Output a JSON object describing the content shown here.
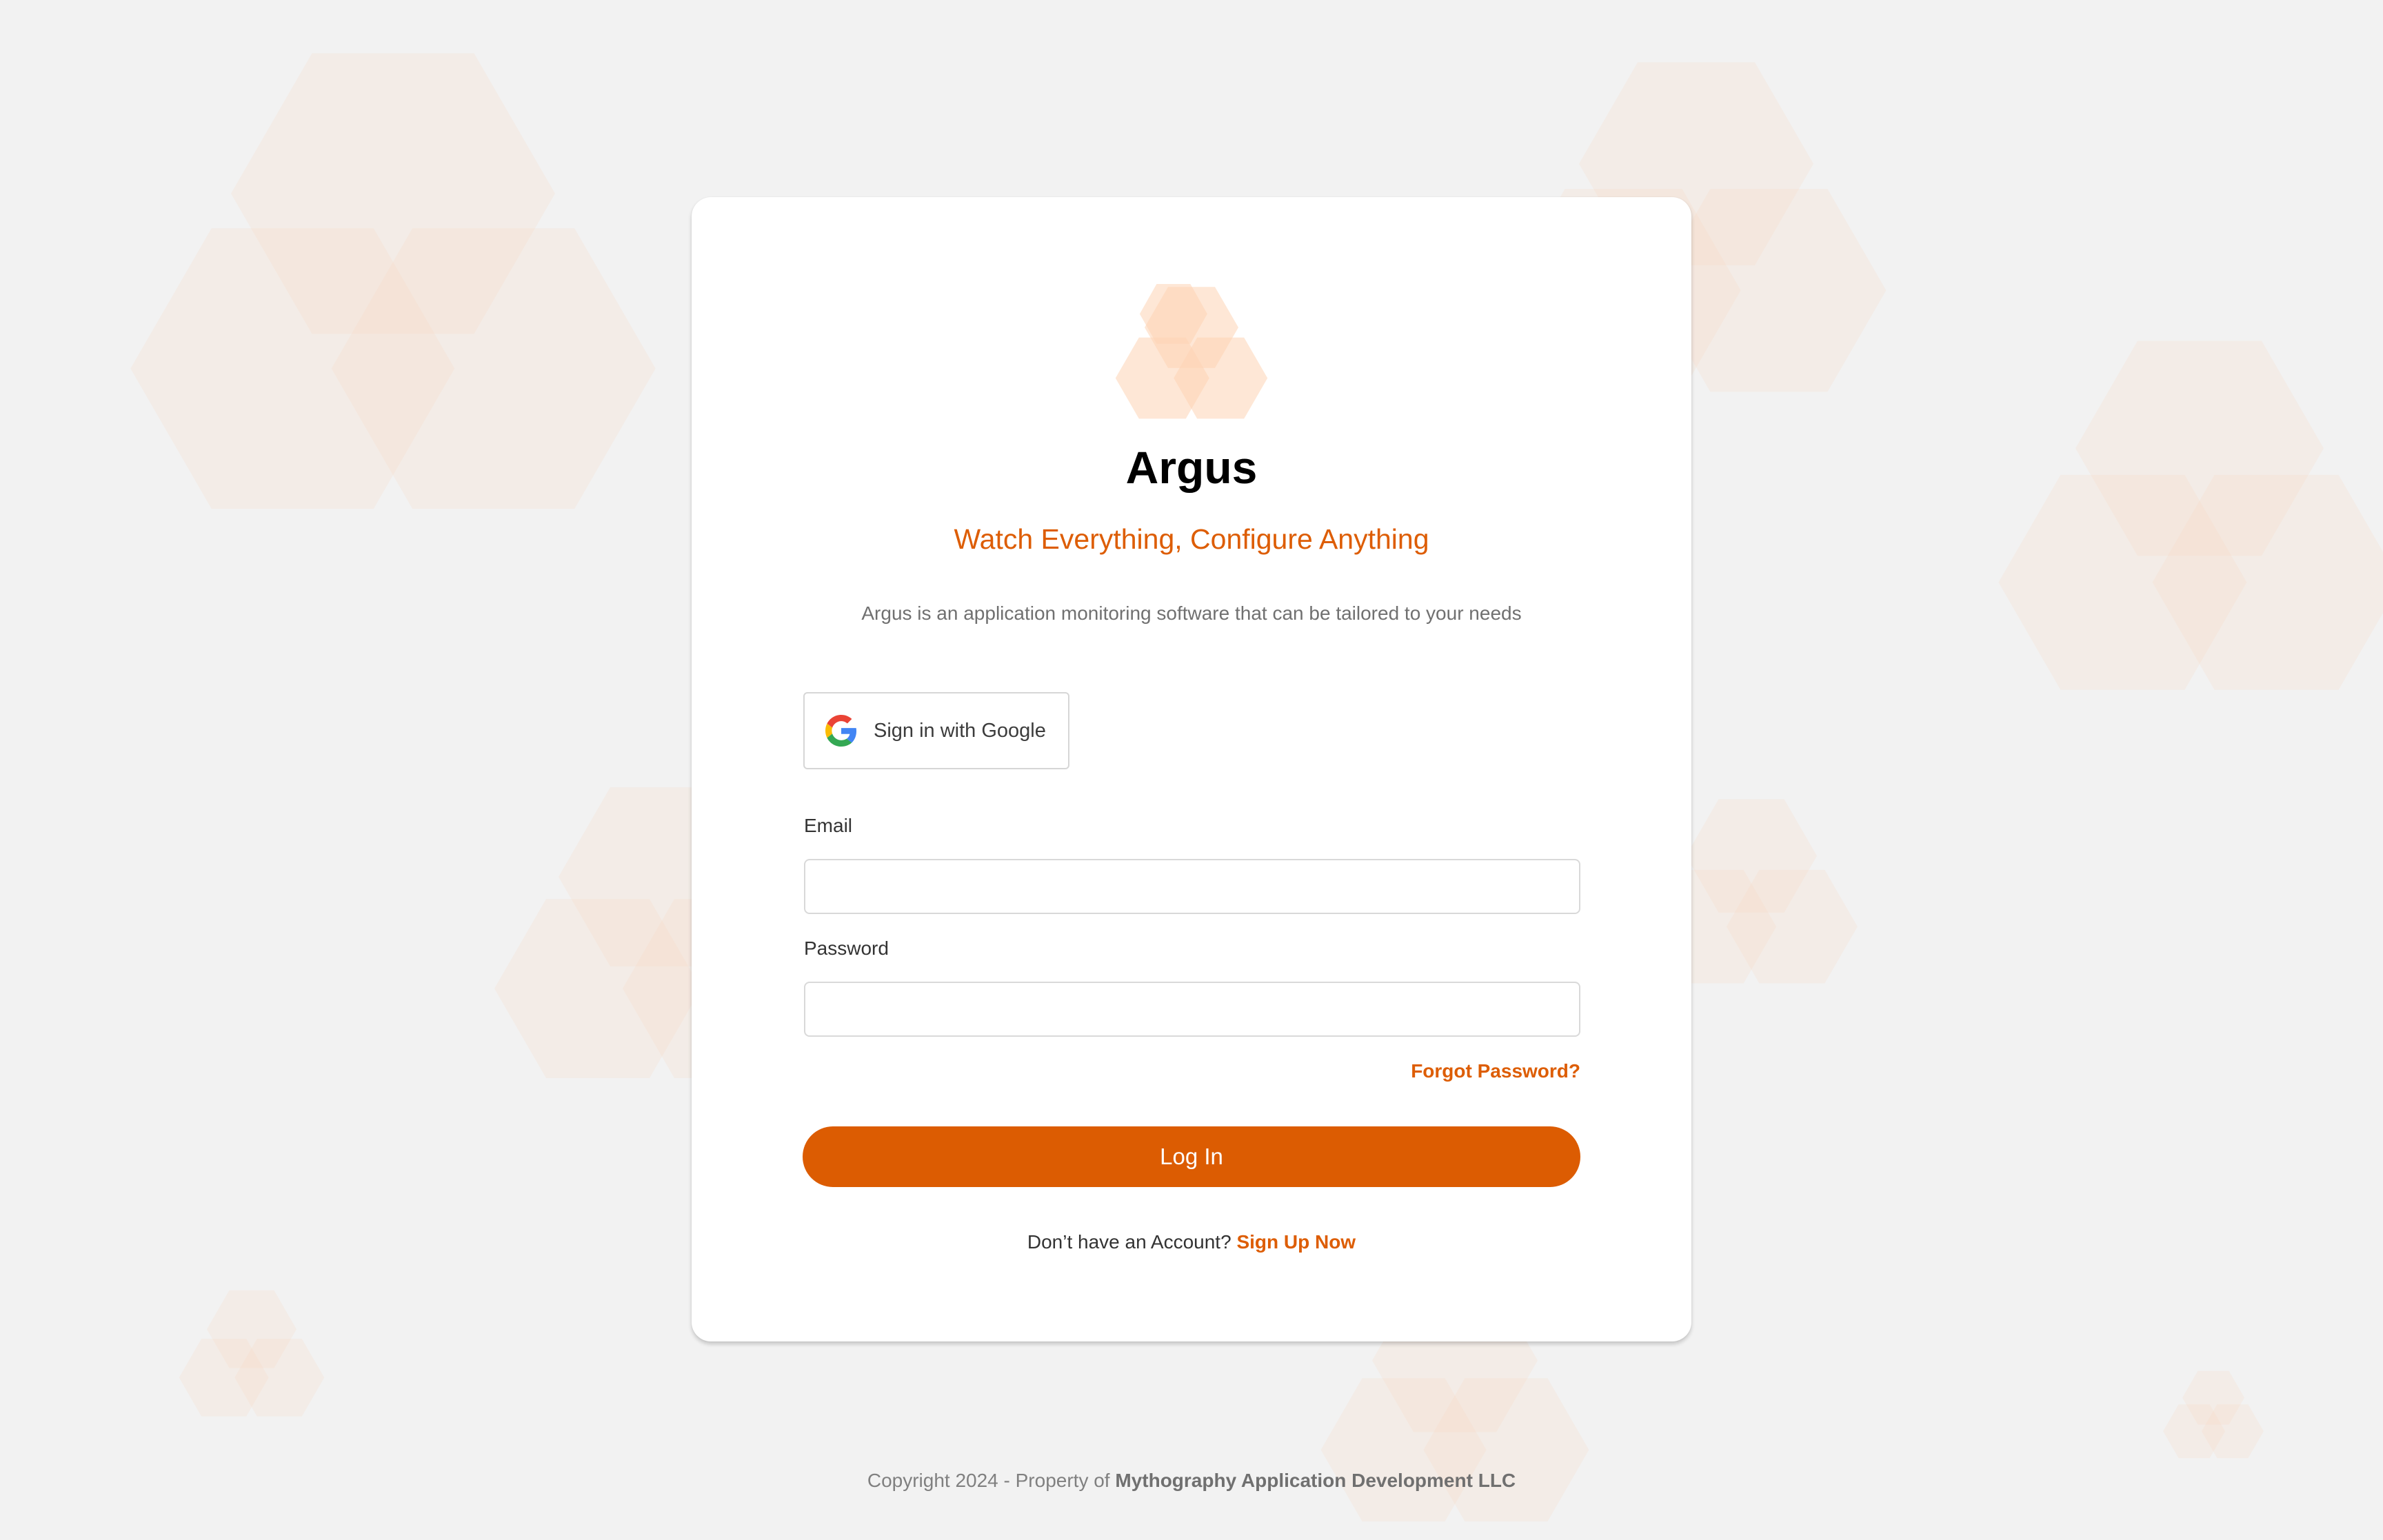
{
  "app": {
    "title": "Argus",
    "tagline": "Watch Everything, Configure Anything",
    "description": "Argus is an application monitoring software that can be tailored to your needs",
    "logo_icon": "argus-hexagon-logo-icon"
  },
  "google_signin": {
    "label": "Sign in with Google",
    "icon": "google-g-icon"
  },
  "form": {
    "email_label": "Email",
    "email_value": "",
    "email_placeholder": "",
    "password_label": "Password",
    "password_value": "",
    "password_placeholder": "",
    "forgot_password": "Forgot Password?",
    "login_button": "Log In",
    "signup_prompt": "Don’t have an Account?",
    "signup_link": "Sign Up Now"
  },
  "footer": {
    "copyright": "Copyright 2024 - Property of",
    "company": "Mythography Application Development LLC"
  },
  "colors": {
    "accent": "#dd5d04",
    "button": "#dc5c02",
    "background": "#f2f2f2",
    "hexagon": "#fde3d0"
  }
}
